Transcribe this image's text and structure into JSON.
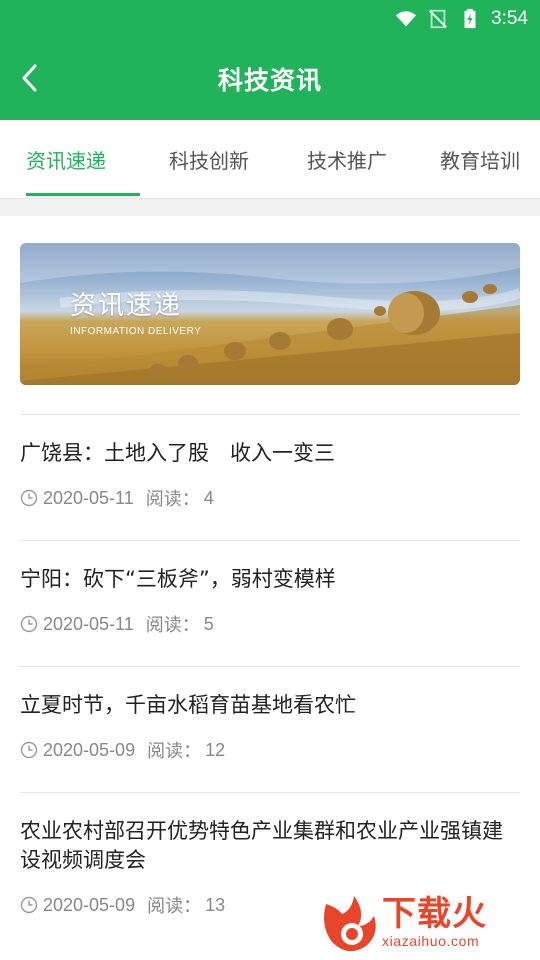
{
  "status_bar": {
    "time": "3:54"
  },
  "app_bar": {
    "title": "科技资讯"
  },
  "tabs": [
    {
      "label": "资讯速递",
      "active": true
    },
    {
      "label": "科技创新",
      "active": false
    },
    {
      "label": "技术推广",
      "active": false
    },
    {
      "label": "教育培训",
      "active": false
    }
  ],
  "banner": {
    "title": "资讯速递",
    "subtitle": "INFORMATION DELIVERY"
  },
  "read_label": "阅读：",
  "news": [
    {
      "title": "广饶县：土地入了股　收入一变三",
      "date": "2020-05-11",
      "reads": "4"
    },
    {
      "title": "宁阳：砍下“三板斧”，弱村变模样",
      "date": "2020-05-11",
      "reads": "5"
    },
    {
      "title": "立夏时节，千亩水稻育苗基地看农忙",
      "date": "2020-05-09",
      "reads": "12"
    },
    {
      "title": "农业农村部召开优势特色产业集群和农业产业强镇建设视频调度会",
      "date": "2020-05-09",
      "reads": "13"
    }
  ],
  "watermark": {
    "text": "下载火",
    "url": "xiazaihuo.com"
  },
  "colors": {
    "accent": "#21b35a",
    "watermark": "#e8462b"
  }
}
